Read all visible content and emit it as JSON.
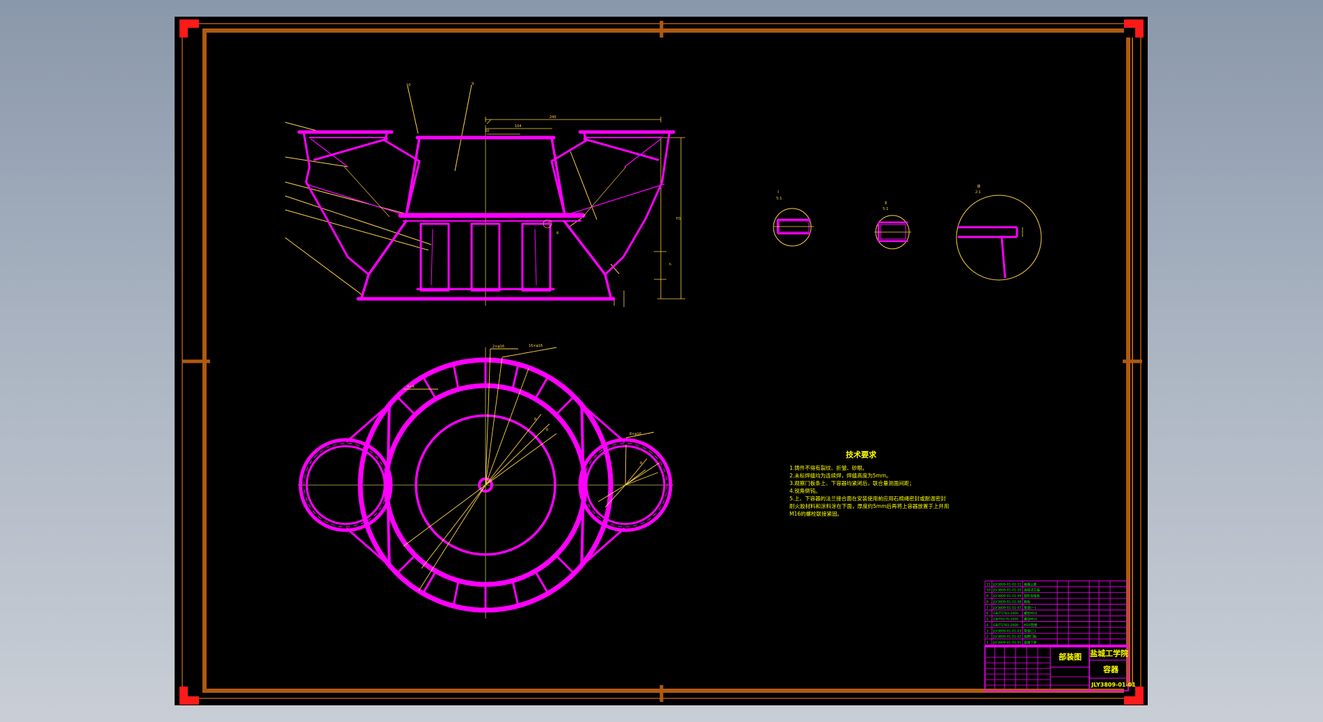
{
  "colors": {
    "background": "#8e9bae",
    "sheet": "#000000",
    "frame": "#b05a10",
    "grips": "#ff1a1a",
    "geometry": "#ff00ff",
    "dimensions": "#ffff00",
    "notes_text": "#ffff00",
    "title_text": "#00ff00",
    "table_lines": "#ff00ff"
  },
  "icons": {
    "grip": "red-square-grip-icon",
    "frame_mark": "frame-center-mark-icon"
  },
  "drawing": {
    "detail_views": [
      "Ⅰ",
      "Ⅱ",
      "Ⅲ"
    ],
    "tech_requirements": {
      "title": "技术要求",
      "items": [
        "1.铸件不得有裂纹、折皱、砂眼。",
        "2.未标焊缝均为连续焊，焊缝高度为5mm。",
        "3.观察门板条上、下容器均紧闭后，联合量测面间距；",
        "4.锐角倒钝。",
        "5.上、下容器的法兰接合面在安装使用前应用石棉绳密封或耐温密封",
        "  耐火胶材料和涂料涂在下面，厚度约5mm后再将上容器放置于上并用",
        "  M16的螺栓联接紧固。"
      ]
    }
  },
  "title_block": {
    "drawing_type": "部装图",
    "school": "盐城工学院",
    "part_name": "容器",
    "drawing_number": "JLY3809-01-01",
    "parts": [
      {
        "no": "11",
        "code": "JLY3809-01-01-11",
        "name": "容器上部"
      },
      {
        "no": "10",
        "code": "JLY3809-01-01-10",
        "name": "连接法兰盘"
      },
      {
        "no": "9",
        "code": "JLY3809-01-01-09",
        "name": "圆形加强板"
      },
      {
        "no": "8",
        "code": "JLY3809-01-01-08",
        "name": "筋板"
      },
      {
        "no": "7",
        "code": "JLY3809-01-01-07",
        "name": "管道(一)"
      },
      {
        "no": "6",
        "code": "GB/T5783-2000",
        "name": "螺栓M16"
      },
      {
        "no": "5",
        "code": "GB/T6170-2000",
        "name": "螺母M16"
      },
      {
        "no": "4",
        "code": "GB/T5781-2000",
        "name": "M16垫圈"
      },
      {
        "no": "3",
        "code": "JLY3809-01-01-03",
        "name": "管道(二)"
      },
      {
        "no": "2",
        "code": "JLY3809-01-01-02",
        "name": "观察门板"
      },
      {
        "no": "1",
        "code": "JLY3809-01-01-01",
        "name": "容器下部"
      }
    ]
  }
}
